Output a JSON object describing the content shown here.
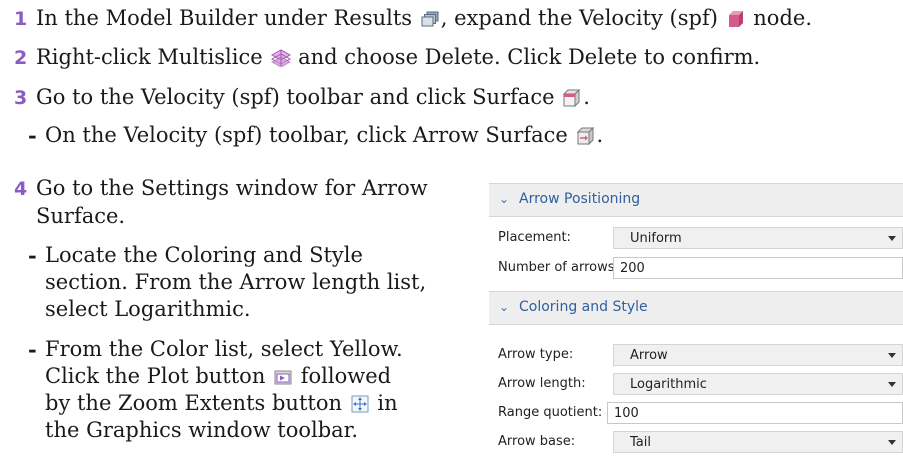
{
  "steps": [
    {
      "num": "1",
      "parts": [
        "In the Model Builder under Results",
        ", expand the Velocity (spf)",
        "node."
      ]
    },
    {
      "num": "2",
      "parts": [
        "Right-click Multislice",
        "and choose Delete. Click Delete to confirm."
      ]
    },
    {
      "num": "3",
      "parts": [
        "Go to the Velocity (spf) toolbar and click Surface",
        "."
      ]
    },
    {
      "num": "4",
      "lines": [
        "Go to the Settings window for Arrow",
        "Surface."
      ]
    }
  ],
  "substeps": {
    "s3a": [
      "On the Velocity (spf) toolbar, click Arrow Surface",
      "."
    ],
    "s4a": [
      "Locate the Coloring and Style",
      "section. From the Arrow length list,",
      "select Logarithmic."
    ],
    "s4b": [
      "From the Color list, select Yellow.",
      "Click the Plot button",
      "followed",
      "by the Zoom Extents button",
      "in",
      "the Graphics window toolbar."
    ]
  },
  "icons": {
    "results": "results-icon",
    "velocity": "3d-plot-group-icon",
    "multislice": "multislice-icon",
    "surface": "surface-icon",
    "arrow_surface": "arrow-surface-icon",
    "plot": "plot-icon",
    "zoom_extents": "zoom-extents-icon"
  },
  "colors": {
    "step_number": "#8a5cc6",
    "section_title": "#2f5f9e"
  },
  "panel": {
    "arrow_positioning": {
      "title": "Arrow Positioning",
      "placement_label": "Placement:",
      "placement_value": "Uniform",
      "num_arrows_label": "Number of arrows:",
      "num_arrows_value": "200"
    },
    "coloring_style": {
      "title": "Coloring and Style",
      "arrow_type_label": "Arrow type:",
      "arrow_type_value": "Arrow",
      "arrow_length_label": "Arrow length:",
      "arrow_length_value": "Logarithmic",
      "range_quotient_label": "Range quotient:",
      "range_quotient_value": "100",
      "arrow_base_label": "Arrow base:",
      "arrow_base_value": "Tail"
    }
  }
}
